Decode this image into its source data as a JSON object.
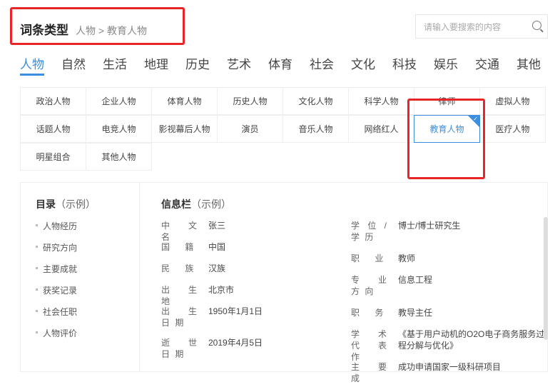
{
  "header": {
    "title": "词条类型",
    "breadcrumb": "人物 > 教育人物"
  },
  "search": {
    "placeholder": "请输入要搜索的内容"
  },
  "tabs": [
    "人物",
    "自然",
    "生活",
    "地理",
    "历史",
    "艺术",
    "体育",
    "社会",
    "文化",
    "科技",
    "娱乐",
    "交通",
    "其他"
  ],
  "subcategories": [
    "政治人物",
    "企业人物",
    "体育人物",
    "历史人物",
    "文化人物",
    "科学人物",
    "律师",
    "虚拟人物",
    "话题人物",
    "电竞人物",
    "影视幕后人物",
    "演员",
    "音乐人物",
    "网络红人",
    "教育人物",
    "医疗人物",
    "明星组合",
    "其他人物"
  ],
  "selected_subcategory": "教育人物",
  "toc": {
    "title": "目录",
    "hint": "（示例）",
    "items": [
      "人物经历",
      "研究方向",
      "主要成就",
      "获奖记录",
      "社会任职",
      "人物评价"
    ]
  },
  "info": {
    "title": "信息栏",
    "hint": "（示例）",
    "left": [
      {
        "k": "中 文 名",
        "v": "张三"
      },
      {
        "k": "国　 籍",
        "v": "中国"
      },
      {
        "k": "民　 族",
        "v": "汉族"
      },
      {
        "k": "出 生 地",
        "v": "北京市"
      },
      {
        "k": "出 生 日 期",
        "v": "1950年1月1日"
      },
      {
        "k": "逝 世 日 期",
        "v": "2019年4月5日"
      }
    ],
    "right": [
      {
        "k": "学 位 / 学 历",
        "v": "博士/博士研究生"
      },
      {
        "k": "职　 业",
        "v": "教师"
      },
      {
        "k": "专 业 方 向",
        "v": "信息工程"
      },
      {
        "k": "职　 务",
        "v": "教导主任"
      },
      {
        "k": "学 术 代 表　 作",
        "v": "《基于用户动机的O2O电子商务服务过程分解与优化》"
      },
      {
        "k": "主 要 成",
        "v": "成功申请国家一级科研项目"
      }
    ]
  }
}
